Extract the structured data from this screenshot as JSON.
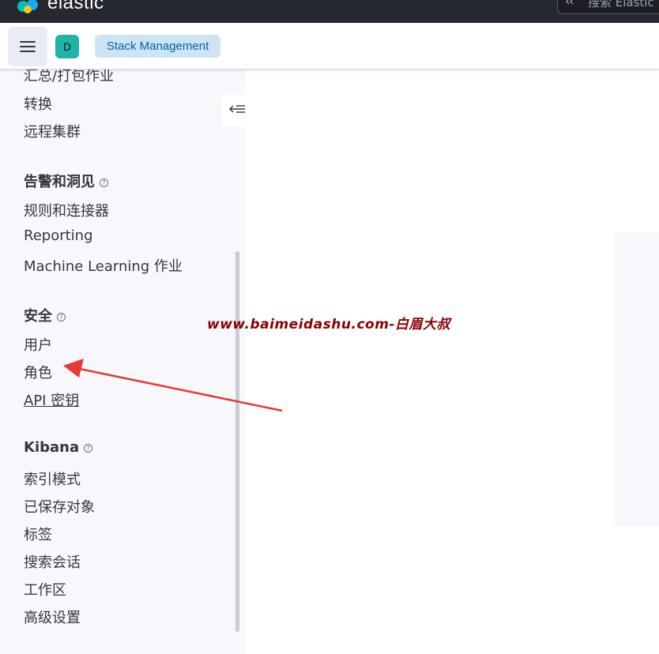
{
  "topbar": {
    "logo_text": "elastic",
    "search_placeholder": "搜索 Elastic"
  },
  "header": {
    "avatar_letter": "D",
    "breadcrumb": "Stack Management"
  },
  "sidebar": {
    "items_top": [
      "汇总/打包作业",
      "转换",
      "远程集群"
    ],
    "group_alerts": {
      "title": "告警和洞见",
      "items": [
        "规则和连接器",
        "Reporting",
        "Machine Learning 作业"
      ]
    },
    "group_security": {
      "title": "安全",
      "items": [
        "用户",
        "角色",
        "API 密钥"
      ]
    },
    "group_kibana": {
      "title": "Kibana",
      "items": [
        "索引模式",
        "已保存对象",
        "标签",
        "搜索会话",
        "工作区",
        "高级设置"
      ]
    }
  },
  "watermark": "www.baimeidashu.com-白眉大叔",
  "colors": {
    "topbar": "#25282f",
    "avatar": "#20b3a7",
    "breadcrumb_bg": "#cce4f5",
    "breadcrumb_text": "#0061a6",
    "arrow": "#e53935",
    "watermark": "#8b0000"
  }
}
